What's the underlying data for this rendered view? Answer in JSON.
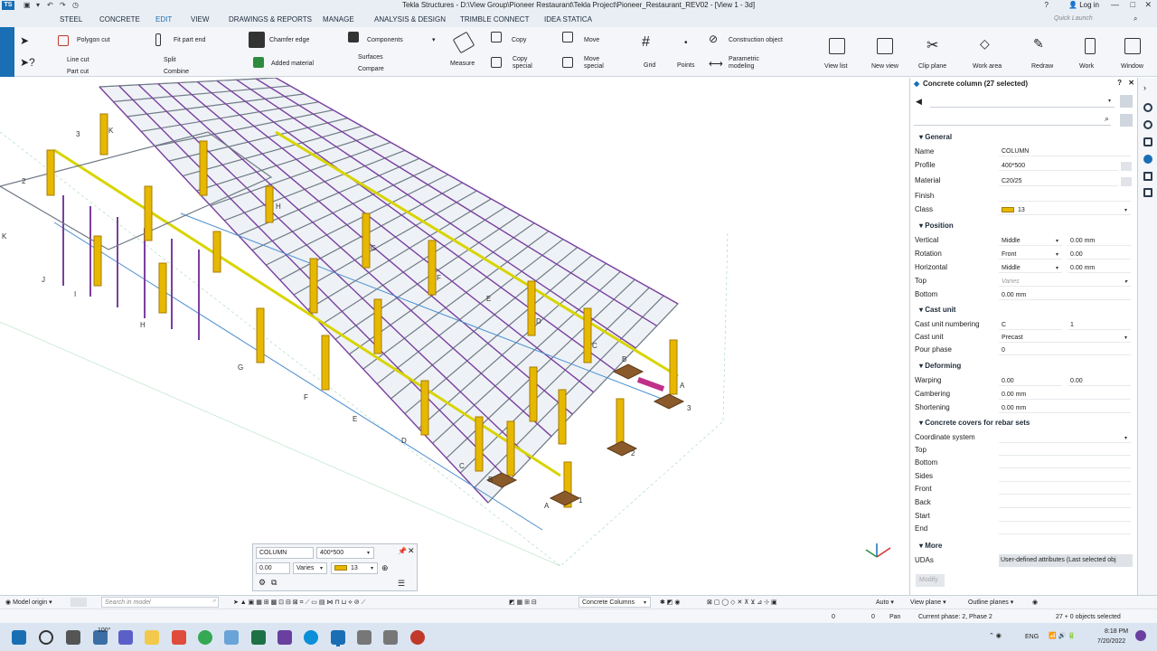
{
  "window": {
    "title": "Tekla Structures - D:\\View Group\\Pioneer Restaurant\\Tekla Project\\Pioneer_Restaurant_REV02 - [View 1 - 3d]",
    "login": "Log in",
    "help": "?"
  },
  "menu": {
    "tabs": [
      "STEEL",
      "CONCRETE",
      "EDIT",
      "VIEW",
      "DRAWINGS & REPORTS",
      "MANAGE",
      "ANALYSIS & DESIGN",
      "TRIMBLE CONNECT",
      "IDEA STATICA"
    ],
    "active": "EDIT",
    "quick_launch": "Quick Launch"
  },
  "ribbon": {
    "polygon_cut": "Polygon cut",
    "line_cut": "Line cut",
    "part_cut": "Part cut",
    "fit_part_end": "Fit part end",
    "split": "Split",
    "combine": "Combine",
    "chamfer_edge": "Chamfer edge",
    "added_material": "Added material",
    "components": "Components",
    "surfaces": "Surfaces",
    "compare": "Compare",
    "measure": "Measure",
    "copy": "Copy",
    "copy_special": "Copy special",
    "move": "Move",
    "move_special": "Move special",
    "grid": "Grid",
    "points": "Points",
    "construction_object": "Construction object",
    "parametric_modeling": "Parametric modeling",
    "view_list": "View list",
    "new_view": "New view",
    "clip_plane": "Clip plane",
    "work_area": "Work area",
    "redraw": "Redraw",
    "work": "Work",
    "window": "Window"
  },
  "grid_labels": [
    "K",
    "J",
    "I",
    "H",
    "G",
    "F",
    "E",
    "D",
    "C",
    "B",
    "A",
    "1",
    "2",
    "3"
  ],
  "properties": {
    "title": "Concrete column (27 selected)",
    "sections": {
      "general": "General",
      "position": "Position",
      "cast_unit": "Cast unit",
      "deforming": "Deforming",
      "covers": "Concrete covers for rebar sets",
      "more": "More"
    },
    "general": {
      "name_label": "Name",
      "name": "COLUMN",
      "profile_label": "Profile",
      "profile": "400*500",
      "material_label": "Material",
      "material": "C20/25",
      "finish_label": "Finish",
      "finish": "",
      "class_label": "Class",
      "class": "13"
    },
    "position": {
      "vertical_label": "Vertical",
      "vertical": "Middle",
      "vertical_offset": "0.00 mm",
      "rotation_label": "Rotation",
      "rotation": "Front",
      "rotation_offset": "0.00",
      "horizontal_label": "Horizontal",
      "horizontal": "Middle",
      "horizontal_offset": "0.00 mm",
      "top_label": "Top",
      "top": "Varies",
      "bottom_label": "Bottom",
      "bottom": "0.00 mm"
    },
    "cast_unit": {
      "numbering_label": "Cast unit numbering",
      "prefix": "C",
      "start": "1",
      "cast_unit_label": "Cast unit",
      "cast_unit": "Precast",
      "pour_phase_label": "Pour phase",
      "pour_phase": "0"
    },
    "deforming": {
      "warping_label": "Warping",
      "warping1": "0.00",
      "warping2": "0.00",
      "cambering_label": "Cambering",
      "cambering": "0.00 mm",
      "shortening_label": "Shortening",
      "shortening": "0.00 mm"
    },
    "covers": {
      "coord_label": "Coordinate system",
      "top": "Top",
      "bottom": "Bottom",
      "sides": "Sides",
      "front": "Front",
      "back": "Back",
      "start": "Start",
      "end": "End"
    },
    "more": {
      "udas_label": "UDAs",
      "udas": "User-defined attributes (Last selected obj",
      "modify": "Modify"
    }
  },
  "contextual_toolbar": {
    "name": "COLUMN",
    "profile": "400*500",
    "value": "0.00",
    "varies": "Varies",
    "class": "13"
  },
  "bottombar": {
    "model_origin": "Model origin",
    "search_placeholder": "Search in model",
    "filter": "Concrete Columns",
    "auto": "Auto",
    "view_plane": "View plane",
    "outline_planes": "Outline planes"
  },
  "statusbar": {
    "x": "0",
    "y": "0",
    "pan": "Pan",
    "phase": "Current phase: 2, Phase 2",
    "selected": "27 + 0 objects selected"
  },
  "taskbar": {
    "lang": "ENG",
    "time": "8:18 PM",
    "date": "7/20/2022",
    "badge": "100°"
  },
  "colors": {
    "accent": "#1a6fb4",
    "column": "#e6b800",
    "steel": "#7a3fa0",
    "beam_yellow": "#d8d400",
    "footing": "#8b5a2b"
  }
}
